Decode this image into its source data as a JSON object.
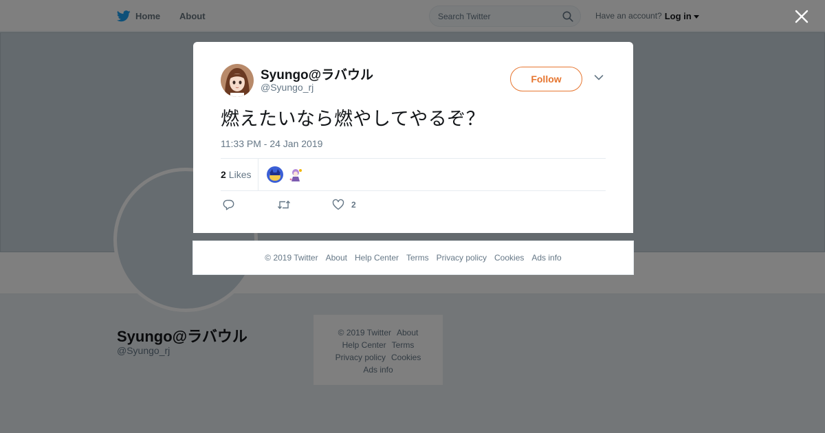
{
  "topbar": {
    "home_label": "Home",
    "about_label": "About",
    "search_placeholder": "Search Twitter",
    "account_prompt": "Have an account?",
    "login_label": "Log in"
  },
  "profile": {
    "name": "Syungo@ラバウル",
    "handle": "@Syungo_rj"
  },
  "side_footer": {
    "links": [
      "© 2019 Twitter",
      "About",
      "Help Center",
      "Terms",
      "Privacy policy",
      "Cookies",
      "Ads info"
    ]
  },
  "tweet": {
    "author_name": "Syungo@ラバウル",
    "author_handle": "@Syungo_rj",
    "follow_label": "Follow",
    "text": "燃えたいなら燃やしてやるぞ？",
    "timestamp": "11:33 PM - 24 Jan 2019",
    "likes_count": "2",
    "likes_label": "Likes",
    "like_action_count": "2"
  },
  "modal_footer": {
    "links": [
      "© 2019 Twitter",
      "About",
      "Help Center",
      "Terms",
      "Privacy policy",
      "Cookies",
      "Ads info"
    ]
  },
  "icons": {
    "logo": "twitter-bird-icon",
    "search": "search-icon",
    "close": "close-icon",
    "chevron": "chevron-down-icon",
    "reply": "reply-icon",
    "retweet": "retweet-icon",
    "like": "heart-icon"
  },
  "colors": {
    "twitter_blue": "#1da1f2",
    "follow_orange": "#e6752f",
    "secondary_text": "#657786"
  }
}
